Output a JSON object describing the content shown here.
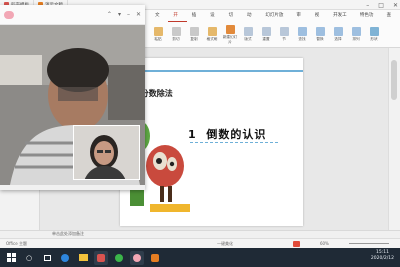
{
  "titlebar": {
    "tabs": [
      {
        "label": "稻壳模板",
        "color": "#d9534f"
      },
      {
        "label": "演示文稿",
        "color": "#e67e22"
      }
    ]
  },
  "ribbon": {
    "menu": [
      "文件",
      "开始",
      "插入",
      "设计",
      "切换",
      "动画",
      "幻灯片放映",
      "审阅",
      "视图",
      "开发工具",
      "特色功能",
      "查找"
    ],
    "active_menu": "开始",
    "tools": [
      "粘贴",
      "剪切",
      "复制",
      "格式刷",
      "新建幻灯片",
      "版式",
      "重置",
      "节",
      "查找",
      "替换",
      "选择",
      "排列",
      "形状"
    ]
  },
  "slide": {
    "unit_label": "元  分数除法",
    "lesson_number": "1",
    "lesson_title": "倒数的认识"
  },
  "notes": {
    "placeholder": "单击此处添加备注"
  },
  "status": {
    "left": "Office 主题",
    "zoom": "60%",
    "pane_label": "一键美化"
  },
  "taskbar": {
    "time": "15:11",
    "date": "2020/2/12"
  },
  "colors": {
    "wps_red": "#c0392b",
    "slide_accent": "#6fb0d8",
    "taskbar": "#1f2a36"
  }
}
